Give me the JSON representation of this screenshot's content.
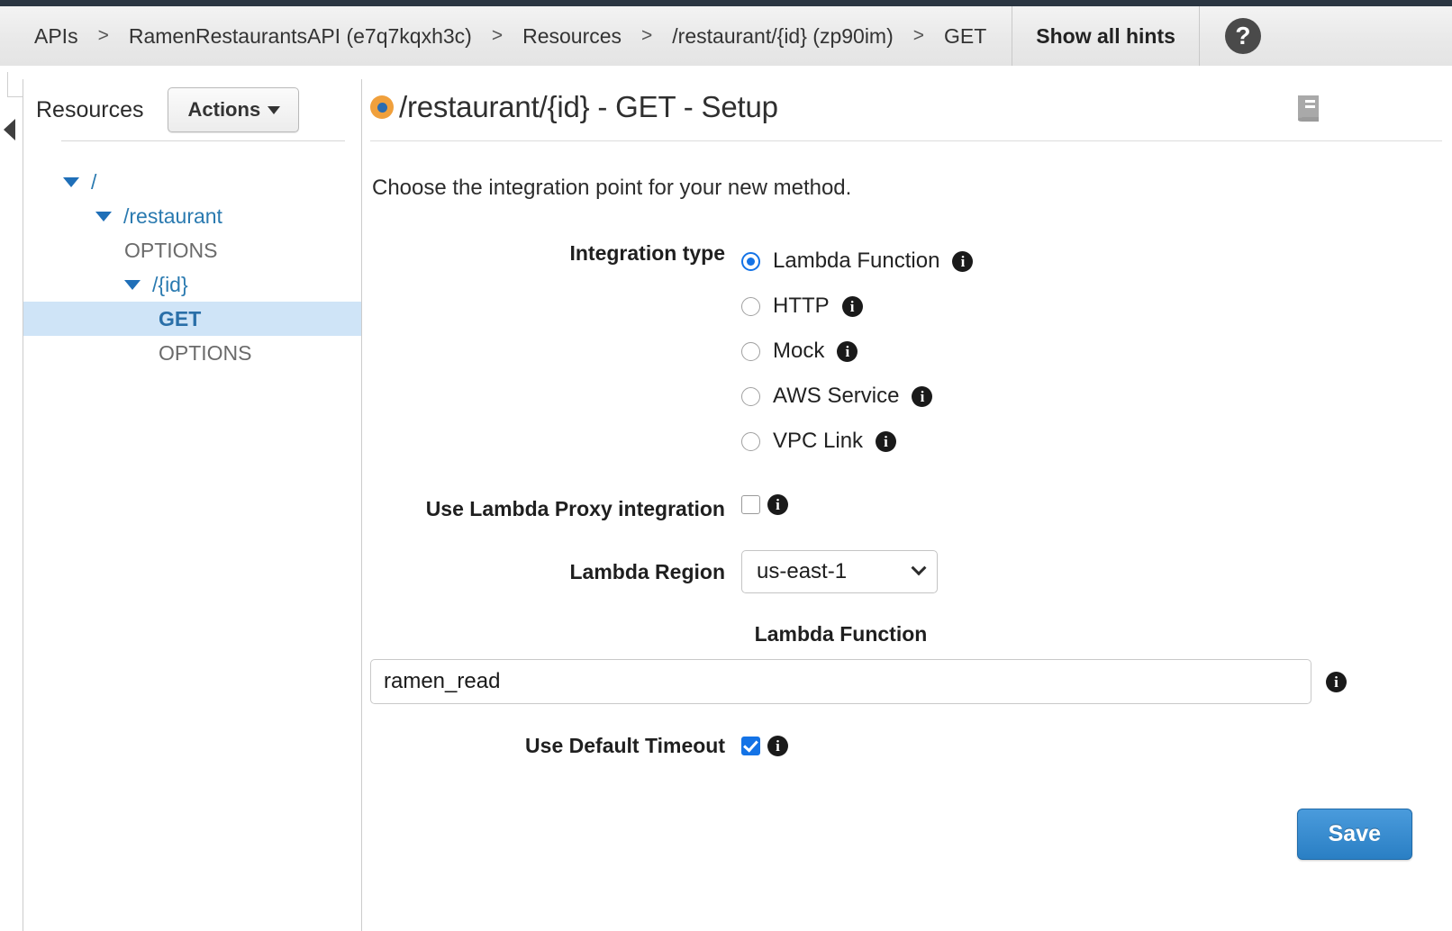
{
  "header": {
    "breadcrumbs": [
      {
        "label": "APIs"
      },
      {
        "label": "RamenRestaurantsAPI (e7q7kqxh3c)"
      },
      {
        "label": "Resources"
      },
      {
        "label": "/restaurant/{id} (zp90im)"
      },
      {
        "label": "GET"
      }
    ],
    "separator": ">",
    "show_hints_label": "Show all hints",
    "help_icon": "question-mark-icon",
    "help_glyph": "?"
  },
  "sidebar": {
    "title": "Resources",
    "actions_label": "Actions",
    "collapse_icon": "collapse-left-arrow-icon",
    "tree": [
      {
        "label": "/",
        "type": "resource",
        "depth": 0,
        "expanded": true,
        "selected": false
      },
      {
        "label": "/restaurant",
        "type": "resource",
        "depth": 1,
        "expanded": true,
        "selected": false
      },
      {
        "label": "OPTIONS",
        "type": "method",
        "depth": 2,
        "expanded": false,
        "selected": false
      },
      {
        "label": "/{id}",
        "type": "resource",
        "depth": 2,
        "expanded": true,
        "selected": false
      },
      {
        "label": "GET",
        "type": "method",
        "depth": 3,
        "expanded": false,
        "selected": true
      },
      {
        "label": "OPTIONS",
        "type": "method",
        "depth": 3,
        "expanded": false,
        "selected": false
      }
    ]
  },
  "main": {
    "title": "/restaurant/{id} - GET - Setup",
    "status_dot": "orange-status-dot",
    "book_icon": "documentation-book-icon",
    "subtitle": "Choose the integration point for your new method.",
    "integration_type": {
      "label": "Integration type",
      "selected": "Lambda Function",
      "options": [
        {
          "label": "Lambda Function",
          "checked": true
        },
        {
          "label": "HTTP",
          "checked": false
        },
        {
          "label": "Mock",
          "checked": false
        },
        {
          "label": "AWS Service",
          "checked": false
        },
        {
          "label": "VPC Link",
          "checked": false
        }
      ]
    },
    "lambda_proxy": {
      "label": "Use Lambda Proxy integration",
      "checked": false
    },
    "lambda_region": {
      "label": "Lambda Region",
      "value": "us-east-1"
    },
    "lambda_function": {
      "label": "Lambda Function",
      "value": "ramen_read",
      "placeholder": ""
    },
    "default_timeout": {
      "label": "Use Default Timeout",
      "checked": true
    },
    "save_label": "Save",
    "info_glyph": "i"
  },
  "colors": {
    "accent_blue": "#1473e6",
    "link_blue": "#2a7ab0",
    "selected_row": "#cfe4f7",
    "status_orange": "#f0a03c",
    "save_blue": "#2a7fc4",
    "header_dark": "#2b3642"
  }
}
